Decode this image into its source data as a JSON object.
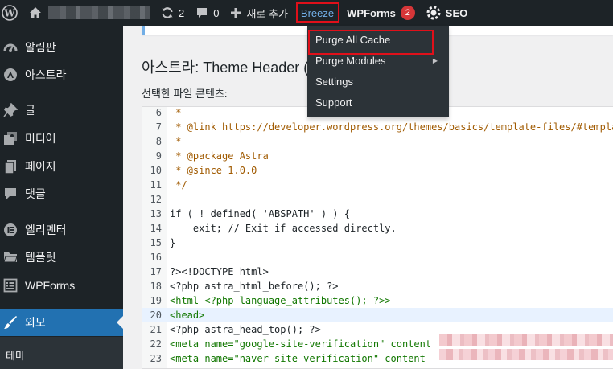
{
  "admin_bar": {
    "comments_count": "0",
    "updates_count": "2",
    "new_label": "새로 추가",
    "breeze_label": "Breeze",
    "wpforms_label": "WPForms",
    "wpforms_badge": "2",
    "seo_label": "SEO",
    "breeze_menu": [
      "Purge All Cache",
      "Purge Modules",
      "Settings",
      "Support"
    ]
  },
  "sidebar": {
    "items": [
      {
        "label": "알림판",
        "icon": "dashboard-icon"
      },
      {
        "label": "아스트라",
        "icon": "astra-icon"
      },
      {
        "label": "글",
        "icon": "pin-icon"
      },
      {
        "label": "미디어",
        "icon": "media-icon"
      },
      {
        "label": "페이지",
        "icon": "pages-icon"
      },
      {
        "label": "댓글",
        "icon": "comments-icon"
      },
      {
        "label": "엘리멘터",
        "icon": "elementor-icon"
      },
      {
        "label": "템플릿",
        "icon": "folder-icon"
      },
      {
        "label": "WPForms",
        "icon": "wpforms-icon"
      },
      {
        "label": "외모",
        "icon": "brush-icon"
      }
    ],
    "submenu": [
      "테마"
    ]
  },
  "content": {
    "heading": "아스트라: Theme Header (h",
    "file_label": "선택한 파일 콘텐츠:"
  },
  "code_lines": [
    {
      "no": "6",
      "text": " *"
    },
    {
      "no": "7",
      "text": " * @link https://developer.wordpress.org/themes/basics/template-files/#template"
    },
    {
      "no": "8",
      "text": " *"
    },
    {
      "no": "9",
      "text": " * @package Astra"
    },
    {
      "no": "10",
      "text": " * @since 1.0.0"
    },
    {
      "no": "11",
      "text": " */"
    },
    {
      "no": "12",
      "text": ""
    },
    {
      "no": "13",
      "text": "if ( ! defined( 'ABSPATH' ) ) {"
    },
    {
      "no": "14",
      "text": "    exit; // Exit if accessed directly."
    },
    {
      "no": "15",
      "text": "}"
    },
    {
      "no": "16",
      "text": ""
    },
    {
      "no": "17",
      "text": "?><!DOCTYPE html>"
    },
    {
      "no": "18",
      "text": "<?php astra_html_before(); ?>"
    },
    {
      "no": "19",
      "text": "<html <?php language_attributes(); ?>>"
    },
    {
      "no": "20",
      "text": "<head>"
    },
    {
      "no": "21",
      "text": "<?php astra_head_top(); ?>"
    },
    {
      "no": "22",
      "text": "<meta name=\"google-site-verification\" content"
    },
    {
      "no": "23",
      "text": "<meta name=\"naver-site-verification\" content"
    }
  ],
  "colors": {
    "adminbar_bg": "#1d2327",
    "active_menu": "#2271b1",
    "highlight_box": "#e0101a",
    "link_blue": "#72aee6"
  }
}
